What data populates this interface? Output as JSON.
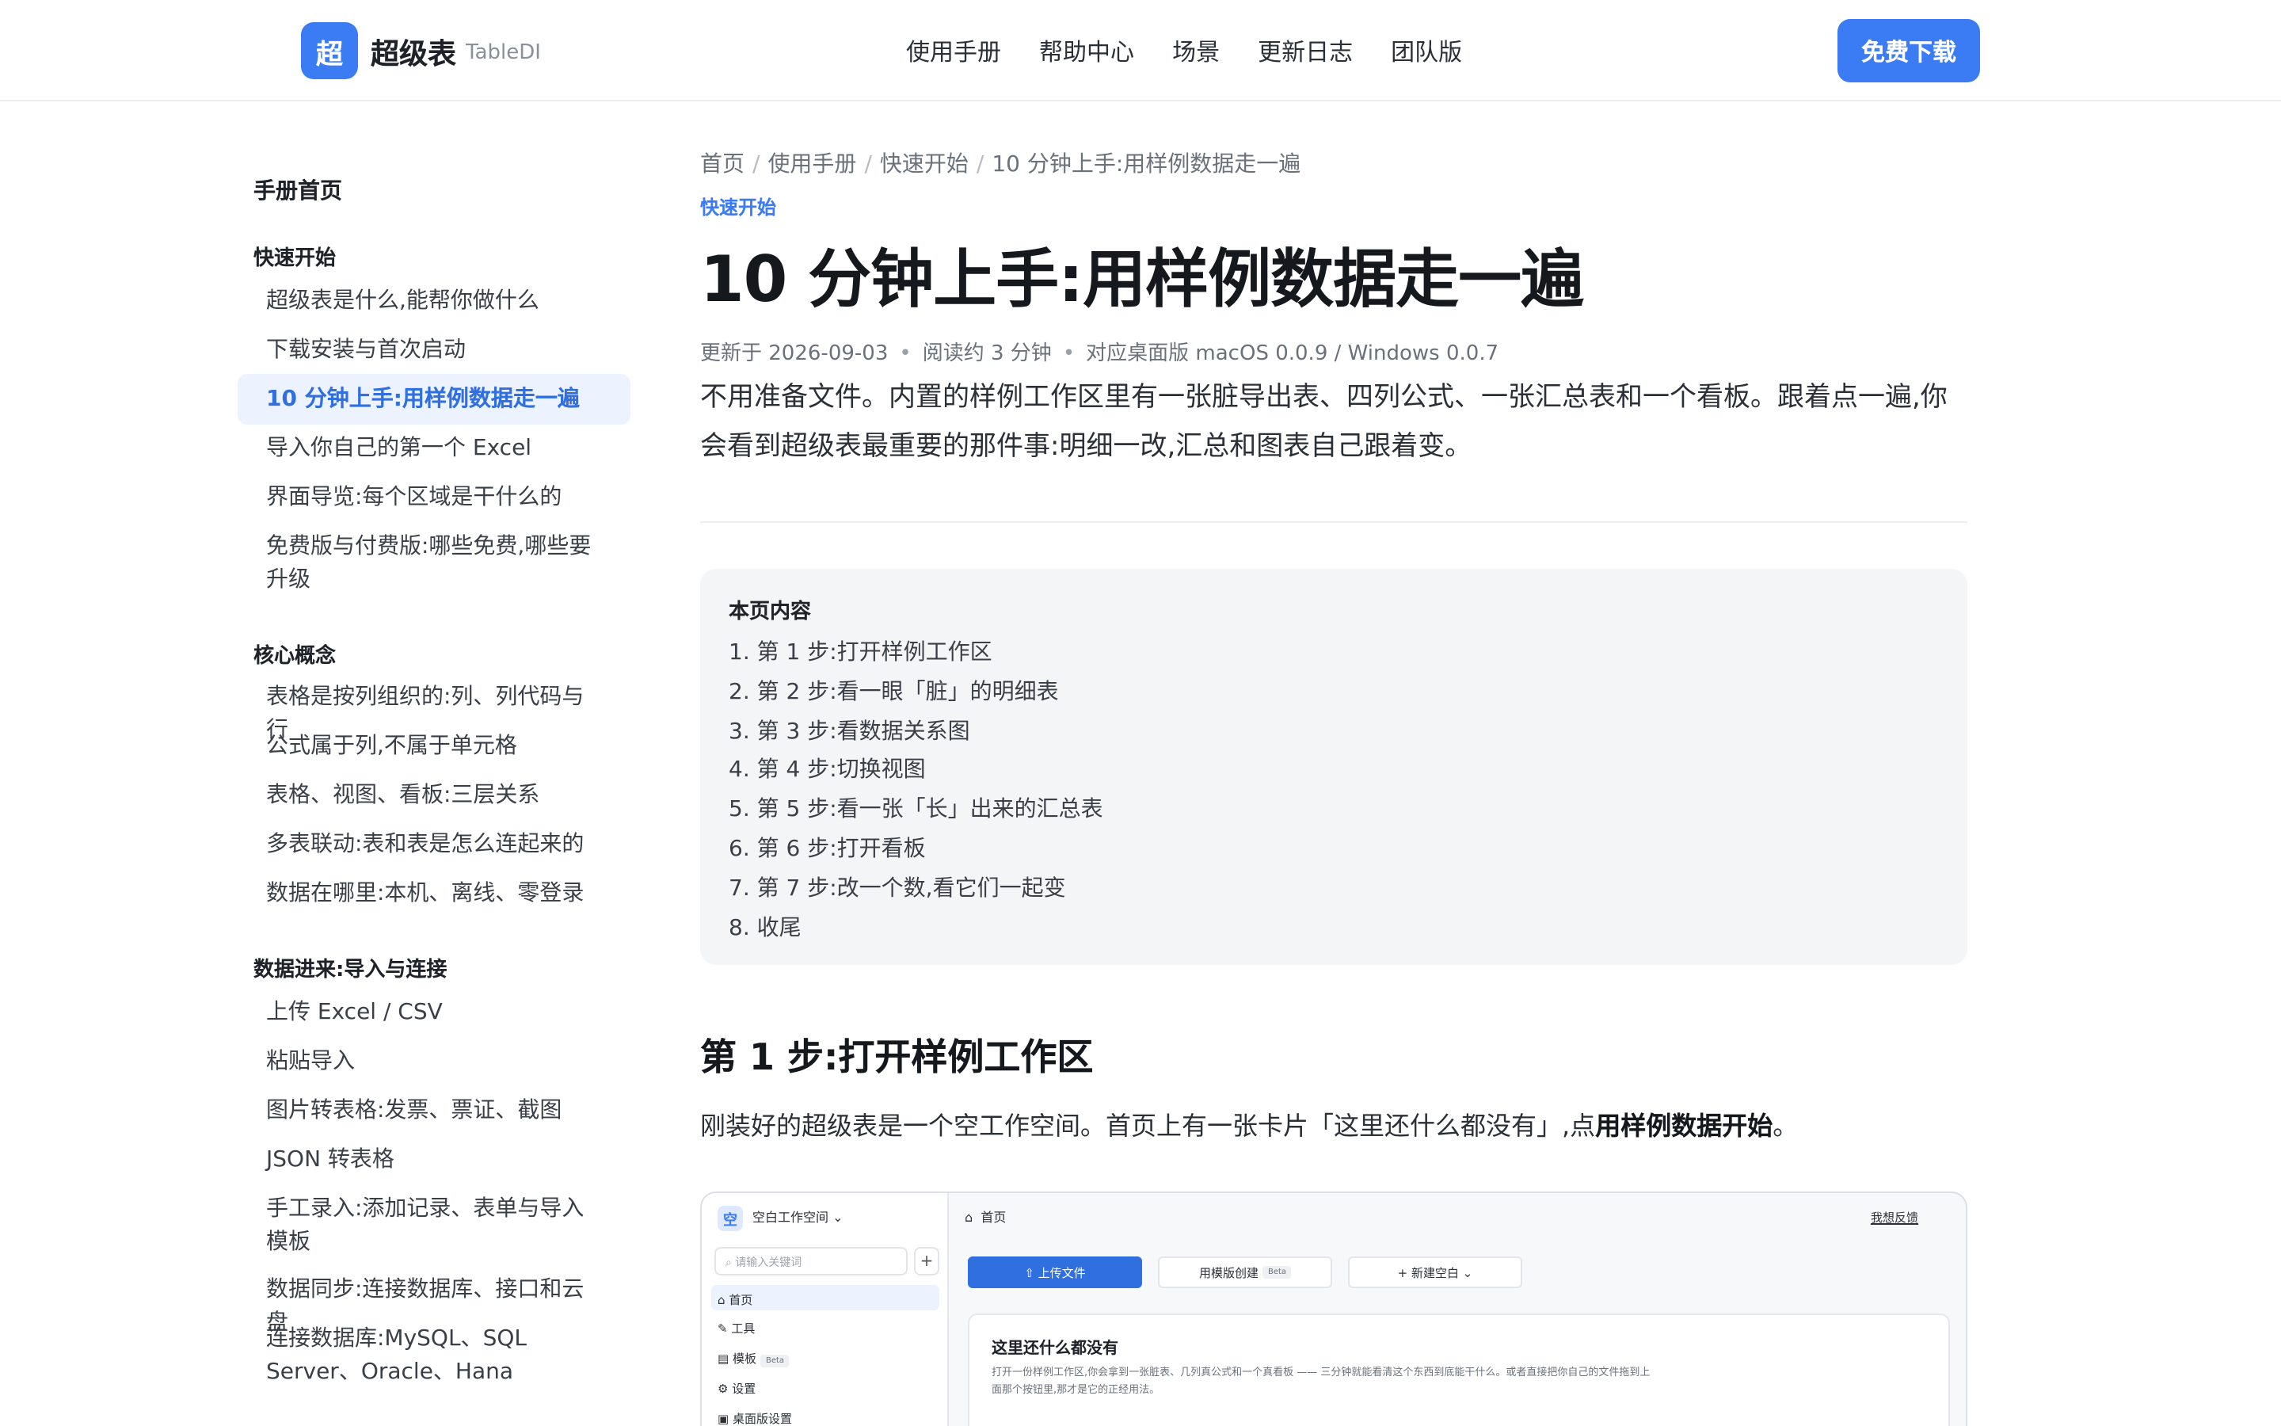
{
  "header": {
    "logo_char": "超",
    "brand": "超级表",
    "brand_sub": "TableDI",
    "nav": [
      "使用手册",
      "帮助中心",
      "场景",
      "更新日志",
      "团队版"
    ],
    "download": "免费下载"
  },
  "sidebar": {
    "home": "手册首页",
    "sections": [
      {
        "title": "快速开始",
        "items": [
          "超级表是什么,能帮你做什么",
          "下载安装与首次启动",
          "10 分钟上手:用样例数据走一遍",
          "导入你自己的第一个 Excel",
          "界面导览:每个区域是干什么的",
          "免费版与付费版:哪些免费,哪些要升级"
        ]
      },
      {
        "title": "核心概念",
        "items": [
          "表格是按列组织的:列、列代码与行",
          "公式属于列,不属于单元格",
          "表格、视图、看板:三层关系",
          "多表联动:表和表是怎么连起来的",
          "数据在哪里:本机、离线、零登录"
        ]
      },
      {
        "title": "数据进来:导入与连接",
        "items": [
          "上传 Excel / CSV",
          "粘贴导入",
          "图片转表格:发票、票证、截图",
          "JSON 转表格",
          "手工录入:添加记录、表单与导入模板",
          "数据同步:连接数据库、接口和云盘",
          "连接数据库:MySQL、SQL Server、Oracle、Hana"
        ]
      }
    ]
  },
  "article": {
    "breadcrumb": [
      "首页",
      "使用手册",
      "快速开始",
      "10 分钟上手:用样例数据走一遍"
    ],
    "tag": "快速开始",
    "title": "10 分钟上手:用样例数据走一遍",
    "meta": [
      "更新于 2026-09-03",
      "阅读约 3 分钟",
      "对应桌面版 macOS 0.0.9 / Windows 0.0.7"
    ],
    "lead": "不用准备文件。内置的样例工作区里有一张脏导出表、四列公式、一张汇总表和一个看板。跟着点一遍,你会看到超级表最重要的那件事:明细一改,汇总和图表自己跟着变。",
    "toc_title": "本页内容",
    "toc": [
      "1. 第 1 步:打开样例工作区",
      "2. 第 2 步:看一眼「脏」的明细表",
      "3. 第 3 步:看数据关系图",
      "4. 第 4 步:切换视图",
      "5. 第 5 步:看一张「长」出来的汇总表",
      "6. 第 6 步:打开看板",
      "7. 第 7 步:改一个数,看它们一起变",
      "8. 收尾"
    ],
    "h2": "第 1 步:打开样例工作区",
    "p1_a": "刚装好的超级表是一个空工作空间。首页上有一张卡片「这里还什么都没有」,点",
    "p1_b": "用样例数据开始",
    "p1_c": "。"
  },
  "screenshot": {
    "ws_icon": "空",
    "ws_name": "空白工作空间 ⌄",
    "search": "请输入关键词",
    "items": [
      "首页",
      "工具",
      "模板",
      "设置",
      "桌面版设置"
    ],
    "beta": "Beta",
    "top": "首页",
    "feedback": "我想反馈",
    "btn_upload": "⇧ 上传文件",
    "btn_template": "用模版创建",
    "btn_new": "+ 新建空白 ⌄",
    "card_title": "这里还什么都没有",
    "card_desc": "打开一份样例工作区,你会拿到一张脏表、几列真公式和一个真看板 —— 三分钟就能看清这个东西到底能干什么。或者直接把你自己的文件拖到上面那个按钮里,那才是它的正经用法。"
  }
}
